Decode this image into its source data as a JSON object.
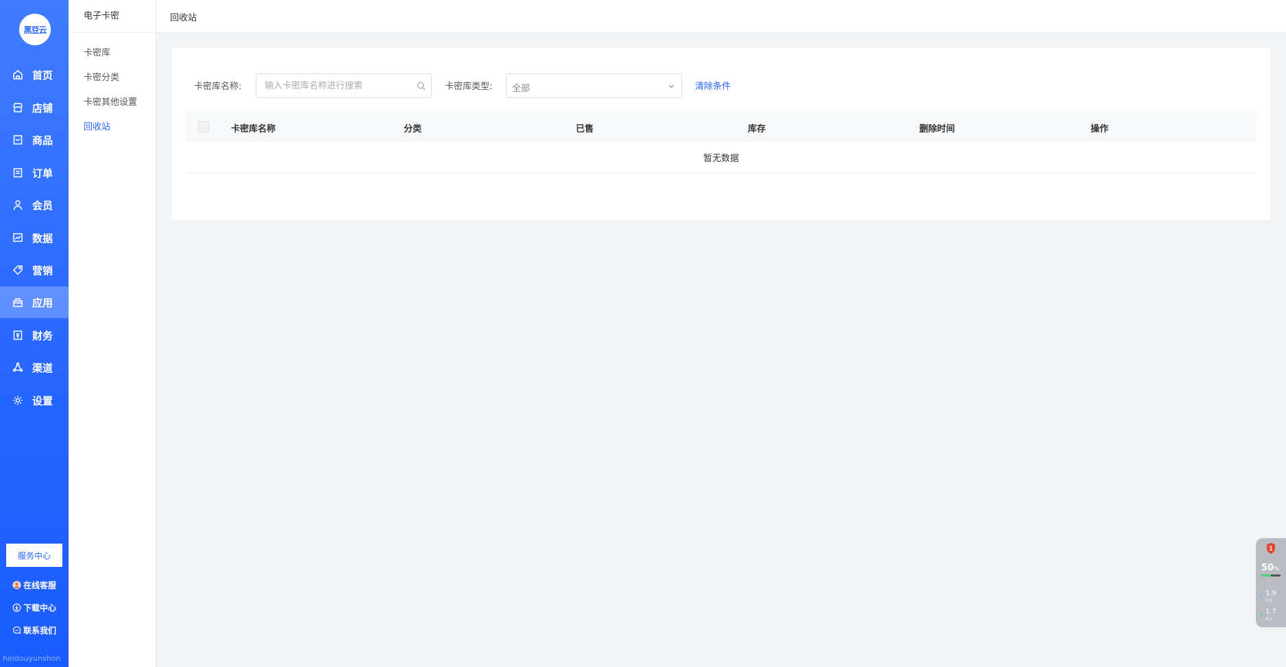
{
  "brand": {
    "logo_text": "黑豆云",
    "watermark": "heidouyunshon"
  },
  "nav": {
    "items": [
      {
        "label": "首页",
        "icon": "home-icon"
      },
      {
        "label": "店铺",
        "icon": "store-icon"
      },
      {
        "label": "商品",
        "icon": "goods-icon"
      },
      {
        "label": "订单",
        "icon": "order-icon"
      },
      {
        "label": "会员",
        "icon": "member-icon"
      },
      {
        "label": "数据",
        "icon": "chart-icon"
      },
      {
        "label": "营销",
        "icon": "tag-icon"
      },
      {
        "label": "应用",
        "icon": "app-icon",
        "active": true
      },
      {
        "label": "财务",
        "icon": "finance-icon"
      },
      {
        "label": "渠道",
        "icon": "channel-icon"
      },
      {
        "label": "设置",
        "icon": "gear-icon"
      }
    ],
    "service_center": "服务中心",
    "online_service": "在线客服",
    "download_center": "下载中心",
    "contact_us": "联系我们"
  },
  "subnav": {
    "title": "电子卡密",
    "items": [
      {
        "label": "卡密库"
      },
      {
        "label": "卡密分类"
      },
      {
        "label": "卡密其他设置"
      },
      {
        "label": "回收站",
        "active": true
      }
    ]
  },
  "breadcrumb": {
    "current": "回收站"
  },
  "filters": {
    "name_label": "卡密库名称:",
    "name_placeholder": "输入卡密库名称进行搜索",
    "type_label": "卡密库类型:",
    "type_value": "全部",
    "clear_label": "清除条件"
  },
  "table": {
    "columns": [
      "卡密库名称",
      "分类",
      "已售",
      "库存",
      "删除时间",
      "操作"
    ],
    "empty_text": "暂无数据"
  },
  "widget": {
    "badge": "1",
    "percent": "50",
    "percent_unit": "%",
    "upload": "1.9",
    "upload_unit": "K/s",
    "download": "1.7",
    "download_unit": "K/s",
    "accent": "#2a66ff"
  }
}
